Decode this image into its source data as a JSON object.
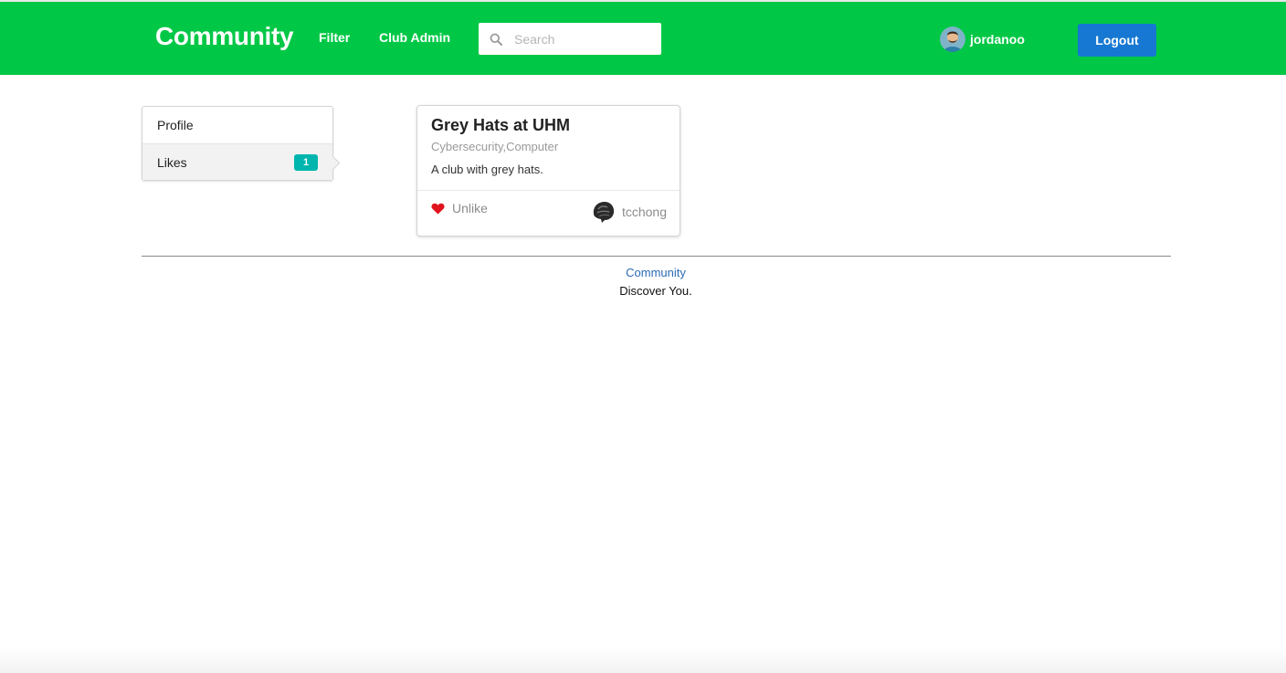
{
  "colors": {
    "navbar": "#00c846",
    "logout_button": "#1678d2",
    "badge": "#00b5ad",
    "heart": "#e0141e",
    "footer_link": "#2b6ab5"
  },
  "navbar": {
    "brand": "Community",
    "links": [
      "Filter",
      "Club Admin"
    ],
    "search": {
      "placeholder": "Search",
      "value": "",
      "icon": "search-icon"
    },
    "user": {
      "name": "jordanoo",
      "avatar_icon": "user-avatar-icon"
    },
    "logout_label": "Logout"
  },
  "sidebar": {
    "items": [
      {
        "label": "Profile",
        "active": false
      },
      {
        "label": "Likes",
        "active": true,
        "badge": "1"
      }
    ]
  },
  "card": {
    "title": "Grey Hats at UHM",
    "meta": "Cybersecurity,Computer",
    "description": "A club with grey hats.",
    "like_icon": "heart-icon",
    "like_label": "Unlike",
    "owner": {
      "name": "tcchong",
      "avatar_icon": "owner-avatar-icon"
    }
  },
  "footer": {
    "link": "Community",
    "tagline": "Discover You."
  }
}
